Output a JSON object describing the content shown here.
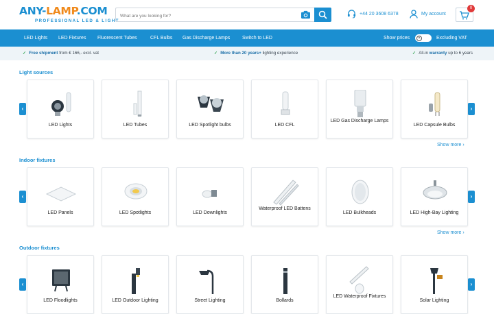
{
  "header": {
    "logo_main_a": "ANY-",
    "logo_main_b": "LAMP",
    "logo_main_c": ".COM",
    "logo_sub": "PROFESSIONAL LED & LIGHT",
    "search_placeholder": "What are you looking for?",
    "phone": "+44 20 3608 6378",
    "account": "My account",
    "cart_count": "0"
  },
  "nav": {
    "items": [
      "LED Lights",
      "LED Fixtures",
      "Fluorescent Tubes",
      "CFL Bulbs",
      "Gas Discharge Lamps",
      "Switch to LED"
    ],
    "show_prices": "Show prices",
    "vat": "Excluding VAT"
  },
  "usp": {
    "shipping_bold": "Free shipment",
    "shipping_rest": " from € 166,- excl. vat",
    "experience_bold": "More than 20 years+",
    "experience_rest": " lighting experience",
    "warranty_pre": "All-in ",
    "warranty_bold": "warranty",
    "warranty_rest": " up to 6 years"
  },
  "sections": [
    {
      "title": "Light sources",
      "items": [
        "LED Lights",
        "LED Tubes",
        "LED Spotlight bulbs",
        "LED CFL",
        "LED Gas Discharge Lamps",
        "LED Capsule Bulbs"
      ],
      "more": "Show more"
    },
    {
      "title": "Indoor fixtures",
      "items": [
        "LED Panels",
        "LED Spotlights",
        "LED Downlights",
        "Waterproof LED Battens",
        "LED Bulkheads",
        "LED High-Bay Lighting"
      ],
      "more": "Show more"
    },
    {
      "title": "Outdoor fixtures",
      "items": [
        "LED Floodlights",
        "LED Outdoor Lighting",
        "Street Lighting",
        "Bollards",
        "LED Waterproof Fixtures",
        "Solar Lighting"
      ]
    }
  ],
  "colors": {
    "brand_blue": "#1b8fd1",
    "brand_orange": "#f08a1c",
    "check_green": "#2aa24a"
  }
}
